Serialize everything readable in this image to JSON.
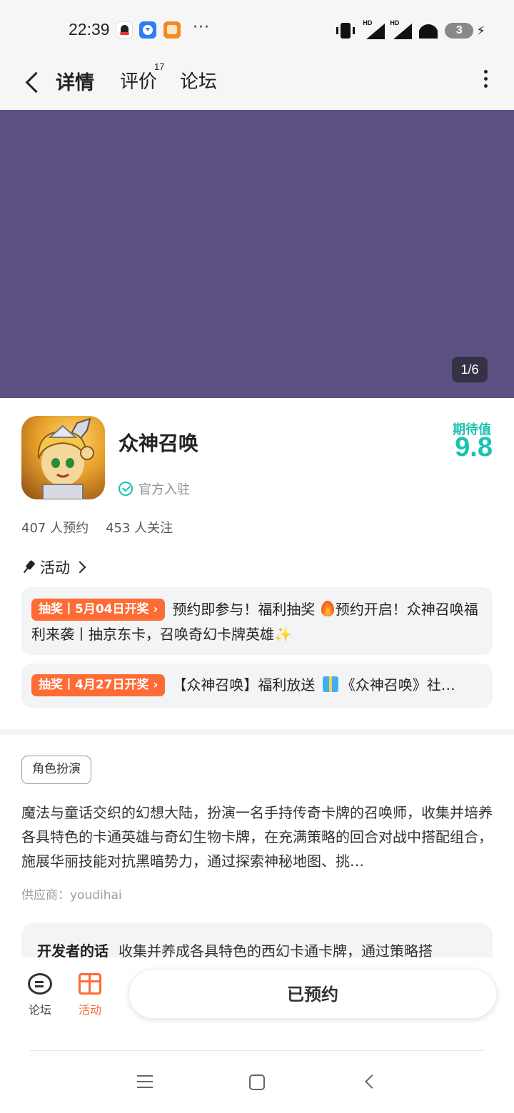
{
  "status_bar": {
    "time": "22:39",
    "more": "···",
    "battery": "3",
    "signal_label": "HD",
    "icons": [
      "qq-icon",
      "download-icon",
      "gift-box-app-icon",
      "vibrate-icon",
      "signal-icon",
      "wifi-icon",
      "battery-icon",
      "charging-icon"
    ]
  },
  "header": {
    "tabs": [
      {
        "label": "详情",
        "active": true
      },
      {
        "label": "评价",
        "count": "17"
      },
      {
        "label": "论坛"
      }
    ]
  },
  "banner": {
    "color": "#5d5182",
    "page_indicator": "1/6"
  },
  "game": {
    "name": "众神召唤",
    "official_label": "官方入驻",
    "expect_label": "期待值",
    "expect_value": "9.8",
    "reservations": "407 人预约",
    "followers": "453 人关注"
  },
  "activity": {
    "heading": "活动",
    "items": [
      {
        "tag": "抽奖丨5月04日开奖",
        "text_before": "预约即参与！福利抽奖 ",
        "text_after": "预约开启！众神召唤福利来袭丨抽京东卡，召唤奇幻卡牌英雄",
        "end_icon": "✨"
      },
      {
        "tag": "抽奖丨4月27日开奖",
        "text_before": "【众神召唤】福利放送 ",
        "text_after": "《众神召唤》社…"
      }
    ]
  },
  "details": {
    "genre": "角色扮演",
    "description": "魔法与童话交织的幻想大陆，扮演一名手持传奇卡牌的召唤师，收集并培养各具特色的卡通英雄与奇幻生物卡牌，在充满策略的回合对战中搭配组合，施展华丽技能对抗黑暗势力，通过探索神秘地图、挑…",
    "supplier": "供应商：youdihai",
    "developer_label": "开发者的话",
    "developer_text": "收集并养成各具特色的西幻卡通卡牌，通过策略搭"
  },
  "bottom_bar": {
    "forum_label": "论坛",
    "activity_label": "活动",
    "reserve_label": "已预约"
  },
  "colors": {
    "accent": "#18c3b0",
    "orange": "#ff6b35",
    "banner": "#5d5182"
  }
}
